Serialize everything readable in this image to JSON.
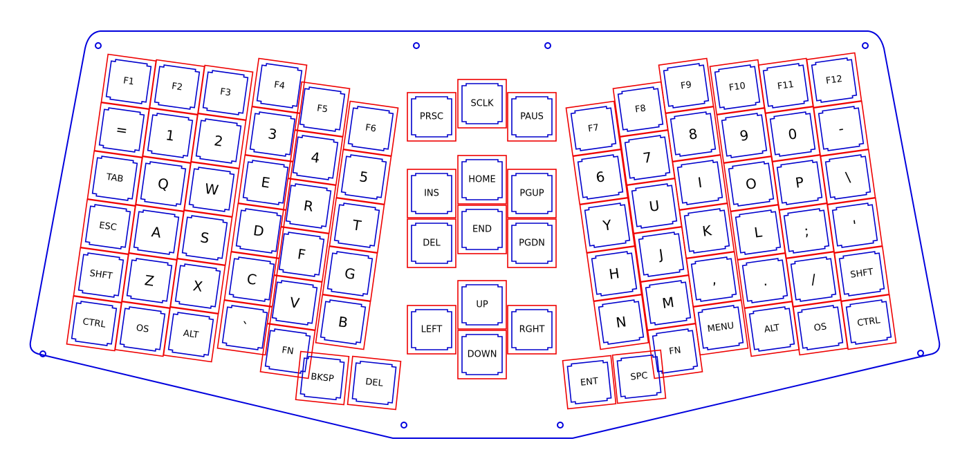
{
  "keyboard": {
    "colors": {
      "plate": "#0000dd",
      "switch_cutout": "#0000cc",
      "keycap_outline": "#ee0000",
      "label": "#000000"
    },
    "left_half": {
      "rows": [
        [
          "F1",
          "F2",
          "F3",
          "F4",
          "F5",
          "F6"
        ],
        [
          "=",
          "1",
          "2",
          "3",
          "4",
          "5"
        ],
        [
          "TAB",
          "Q",
          "W",
          "E",
          "R",
          "T"
        ],
        [
          "ESC",
          "A",
          "S",
          "D",
          "F",
          "G"
        ],
        [
          "SHFT",
          "Z",
          "X",
          "C",
          "V",
          "B"
        ],
        [
          "CTRL",
          "OS",
          "ALT",
          "`",
          "FN"
        ]
      ],
      "thumb": [
        "BKSP",
        "DEL"
      ]
    },
    "center_cluster": {
      "system": [
        "PRSC",
        "SCLK",
        "PAUS"
      ],
      "nav": [
        "INS",
        "HOME",
        "PGUP",
        "DEL",
        "END",
        "PGDN"
      ],
      "arrows": [
        "UP",
        "LEFT",
        "DOWN",
        "RGHT"
      ]
    },
    "right_half": {
      "rows": [
        [
          "F7",
          "F8",
          "F9",
          "F10",
          "F11",
          "F12"
        ],
        [
          "6",
          "7",
          "8",
          "9",
          "0",
          "-"
        ],
        [
          "Y",
          "U",
          "I",
          "O",
          "P",
          "\\"
        ],
        [
          "H",
          "J",
          "K",
          "L",
          ";",
          "'"
        ],
        [
          "N",
          "M",
          ",",
          ".",
          "/",
          "SHFT"
        ],
        [
          "FN",
          "MENU",
          "ALT",
          "OS",
          "CTRL"
        ]
      ],
      "thumb": [
        "ENT",
        "SPC"
      ]
    }
  }
}
